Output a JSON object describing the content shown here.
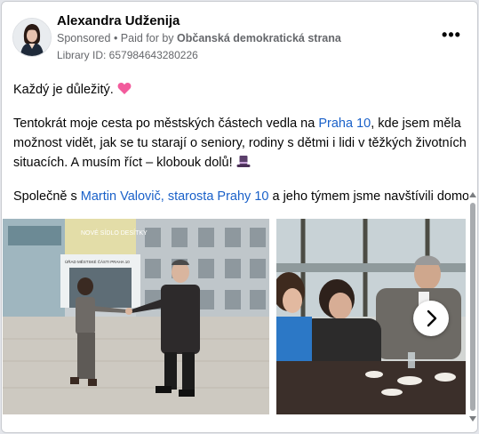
{
  "post": {
    "author": "Alexandra Udženija",
    "sponsored": "Sponsored",
    "paid_for_prefix": " • Paid for by ",
    "paid_for": "Občanská demokratická strana",
    "library_id": "Library ID: 657984643280226",
    "more_icon": "more-horizontal-icon"
  },
  "text": {
    "p1": "Každý je důležitý.",
    "p1_emoji": "heart-icon",
    "p2_a": "Tentokrát moje cesta po městských částech vedla na ",
    "p2_link": "Praha 10",
    "p2_b": ", kde jsem měla možnost vidět, jak se tu starají o seniory, rodiny s dětmi i lidi v těžkých životních situacích. A musím říct – klobouk dolů! ",
    "p2_emoji": "top-hat-icon",
    "p3_a": "Společně s ",
    "p3_link": "Martin Valovič, starosta Prahy 10",
    "p3_b": " a jeho týmem jsme navštívili domov..."
  },
  "media": {
    "image1_sign1": "ÚŘAD MĚSTSKÉ ČÁSTI PRAHA 10",
    "image1_sign2": "NOVÉ SÍDLO DESÍTKY",
    "next_icon": "chevron-right-icon"
  },
  "colors": {
    "link": "#1a61c9",
    "heart": "#f25b9c",
    "text": "#050505",
    "secondary": "#65676b"
  }
}
